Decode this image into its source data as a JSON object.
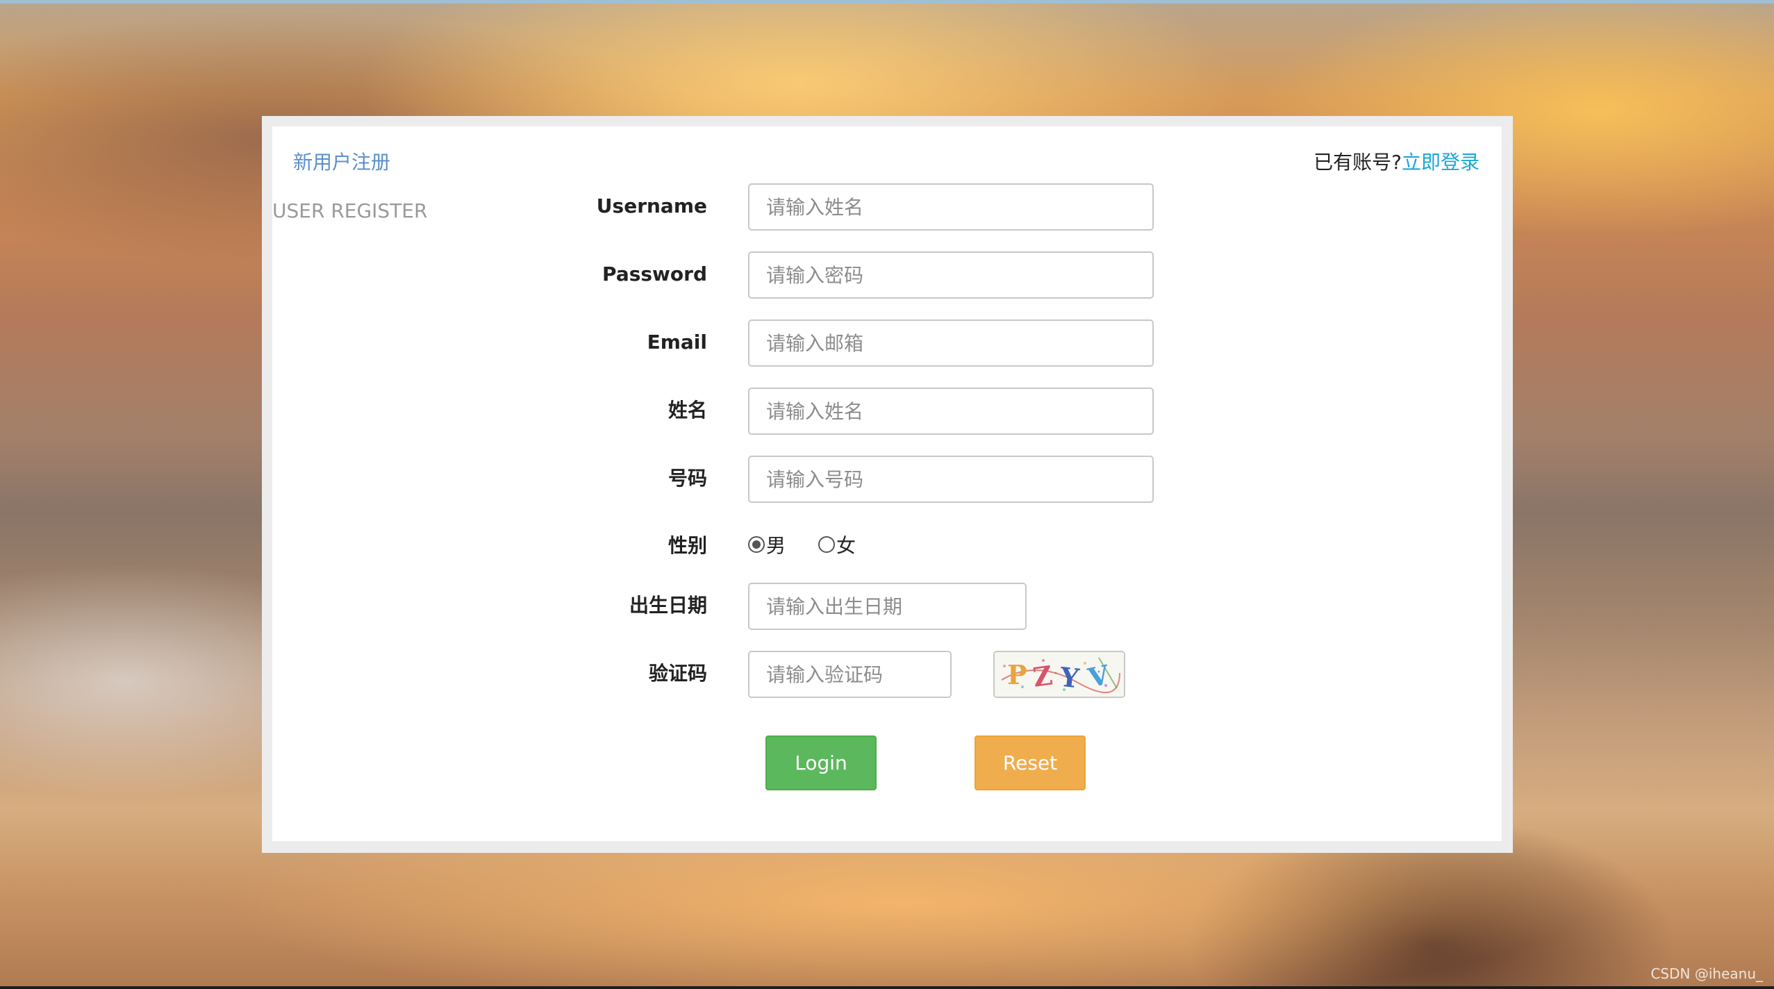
{
  "header": {
    "new_user_title": "新用户注册",
    "subtitle": "USER REGISTER",
    "have_account_text": "已有账号?",
    "login_link": "立即登录"
  },
  "form": {
    "username": {
      "label": "Username",
      "placeholder": "请输入姓名",
      "value": ""
    },
    "password": {
      "label": "Password",
      "placeholder": "请输入密码",
      "value": ""
    },
    "email": {
      "label": "Email",
      "placeholder": "请输入邮箱",
      "value": ""
    },
    "name": {
      "label": "姓名",
      "placeholder": "请输入姓名",
      "value": ""
    },
    "phone": {
      "label": "号码",
      "placeholder": "请输入号码",
      "value": ""
    },
    "gender": {
      "label": "性别",
      "options": [
        "男",
        "女"
      ],
      "selected": "男"
    },
    "birthday": {
      "label": "出生日期",
      "placeholder": "请输入出生日期",
      "value": ""
    },
    "captcha": {
      "label": "验证码",
      "placeholder": "请输入验证码",
      "value": "",
      "image_text": "PZYV"
    }
  },
  "buttons": {
    "login": "Login",
    "reset": "Reset"
  },
  "watermark": "CSDN @iheanu_",
  "colors": {
    "link_blue": "#19a7d8",
    "title_blue": "#5b8fc9",
    "login_green": "#5cb85c",
    "reset_orange": "#f0ad4e"
  }
}
